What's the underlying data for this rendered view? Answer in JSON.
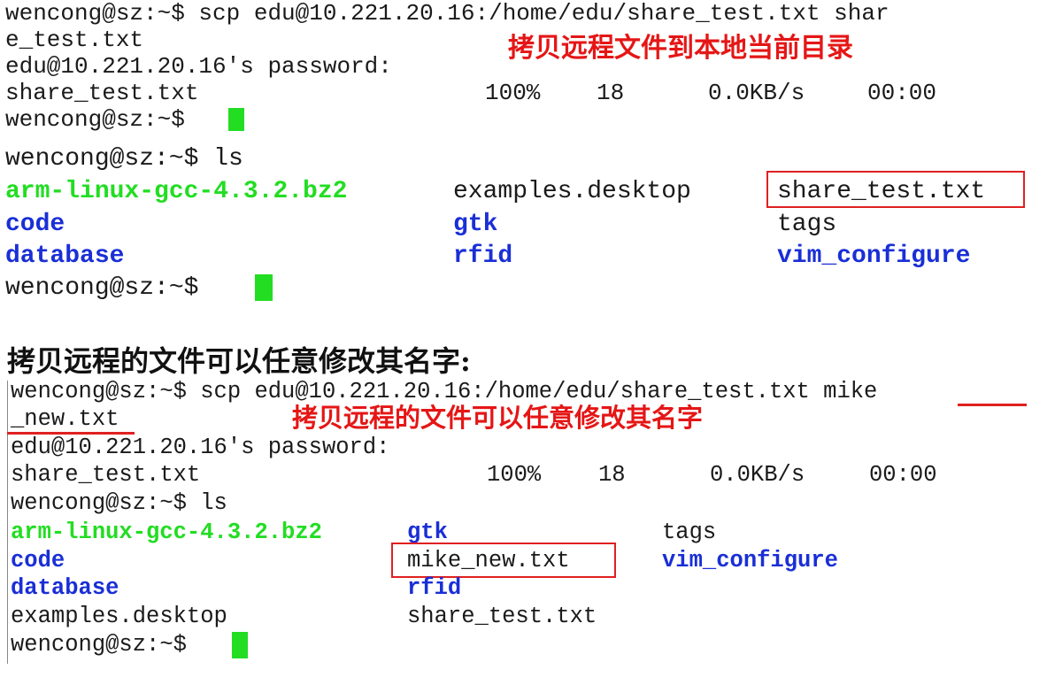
{
  "terminal1": {
    "cmd_a": "wencong@sz:~$ scp edu@10.221.20.16:/home/edu/share_test.txt shar",
    "cmd_b": "e_test.txt",
    "password_prompt": "edu@10.221.20.16's password:",
    "transfer": {
      "file": "share_test.txt",
      "percent": "100%",
      "size": "18",
      "rate": "0.0KB/s",
      "time": "00:00"
    },
    "prompt": "wencong@sz:~$",
    "ls_cmd": "wencong@sz:~$ ls",
    "ls": {
      "col1": [
        "arm-linux-gcc-4.3.2.bz2",
        "code",
        "database"
      ],
      "col2": [
        "examples.desktop",
        "gtk",
        "rfid"
      ],
      "col3": [
        "share_test.txt",
        "tags",
        "vim_configure"
      ]
    },
    "annotation": "拷贝远程文件到本地当前目录"
  },
  "heading": "拷贝远程的文件可以任意修改其名字:",
  "terminal2": {
    "cmd_a": "wencong@sz:~$ scp edu@10.221.20.16:/home/edu/share_test.txt mike",
    "cmd_b": "_new.txt",
    "password_prompt": "edu@10.221.20.16's password:",
    "transfer": {
      "file": "share_test.txt",
      "percent": "100%",
      "size": "18",
      "rate": "0.0KB/s",
      "time": "00:00"
    },
    "ls_cmd": "wencong@sz:~$ ls",
    "prompt": "wencong@sz:~$",
    "ls": {
      "col1": [
        "arm-linux-gcc-4.3.2.bz2",
        "code",
        "database",
        "examples.desktop"
      ],
      "col2": [
        "gtk",
        "mike_new.txt",
        "rfid",
        "share_test.txt"
      ],
      "col3": [
        "tags",
        "vim_configure"
      ]
    },
    "annotation": "拷贝远程的文件可以任意修改其名字"
  },
  "colors": {
    "executable": "#22dd22",
    "directory": "#1a2fd6",
    "annotation": "#e51616",
    "cursor": "#22dd22"
  }
}
